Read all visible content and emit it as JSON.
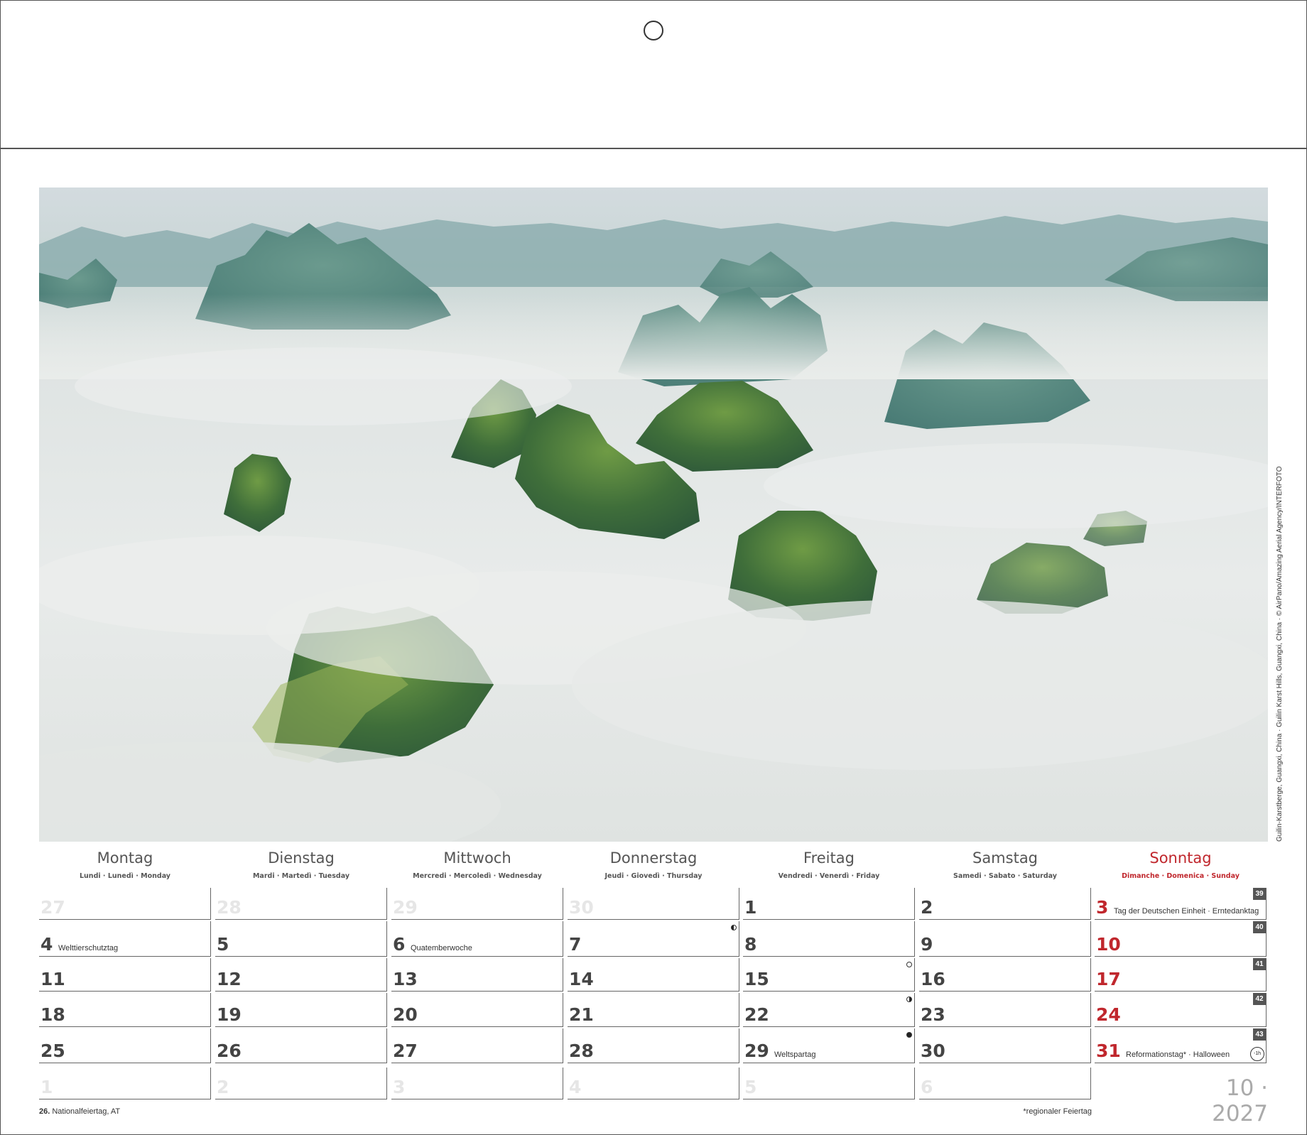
{
  "photo": {
    "credit": "Guilin-Karstberge, Guangxi, China · Guilin Karst Hills, Guangxi, China · © AirPano/Amazing Aerial Agency/INTERFOTO"
  },
  "weekdays": [
    {
      "name": "Montag",
      "sub": "Lundi · Lunedì · Monday"
    },
    {
      "name": "Dienstag",
      "sub": "Mardi · Martedì · Tuesday"
    },
    {
      "name": "Mittwoch",
      "sub": "Mercredi · Mercoledì · Wednesday"
    },
    {
      "name": "Donnerstag",
      "sub": "Jeudi · Giovedì · Thursday"
    },
    {
      "name": "Freitag",
      "sub": "Vendredi · Venerdì · Friday"
    },
    {
      "name": "Samstag",
      "sub": "Samedi · Sabato · Saturday"
    },
    {
      "name": "Sonntag",
      "sub": "Dimanche · Domenica · Sunday"
    }
  ],
  "weeks": [
    {
      "kw": "39",
      "days": [
        {
          "n": "27",
          "faded": true
        },
        {
          "n": "28",
          "faded": true
        },
        {
          "n": "29",
          "faded": true
        },
        {
          "n": "30",
          "faded": true
        },
        {
          "n": "1"
        },
        {
          "n": "2"
        },
        {
          "n": "3",
          "note": "Tag der Deutschen Einheit  ·  Erntedanktag"
        }
      ]
    },
    {
      "kw": "40",
      "days": [
        {
          "n": "4",
          "note": "Welttierschutztag"
        },
        {
          "n": "5"
        },
        {
          "n": "6",
          "note": "Quatemberwoche"
        },
        {
          "n": "7",
          "moon": "last"
        },
        {
          "n": "8"
        },
        {
          "n": "9"
        },
        {
          "n": "10"
        }
      ]
    },
    {
      "kw": "41",
      "days": [
        {
          "n": "11"
        },
        {
          "n": "12"
        },
        {
          "n": "13"
        },
        {
          "n": "14"
        },
        {
          "n": "15",
          "moon": "full"
        },
        {
          "n": "16"
        },
        {
          "n": "17"
        }
      ]
    },
    {
      "kw": "42",
      "days": [
        {
          "n": "18"
        },
        {
          "n": "19"
        },
        {
          "n": "20"
        },
        {
          "n": "21"
        },
        {
          "n": "22",
          "moon": "first"
        },
        {
          "n": "23"
        },
        {
          "n": "24"
        }
      ]
    },
    {
      "kw": "43",
      "days": [
        {
          "n": "25"
        },
        {
          "n": "26"
        },
        {
          "n": "27"
        },
        {
          "n": "28"
        },
        {
          "n": "29",
          "note": "Weltspartag",
          "moon": "new"
        },
        {
          "n": "30"
        },
        {
          "n": "31",
          "note": "Reformationstag*  ·  Halloween",
          "clock": "-1h"
        }
      ]
    },
    {
      "days": [
        {
          "n": "1",
          "faded": true
        },
        {
          "n": "2",
          "faded": true
        },
        {
          "n": "3",
          "faded": true
        },
        {
          "n": "4",
          "faded": true
        },
        {
          "n": "5",
          "faded": true
        },
        {
          "n": "6",
          "faded": true
        }
      ]
    }
  ],
  "month_label": "10 · 2027",
  "footer": {
    "left_day": "26.",
    "left_text": "Nationalfeiertag, AT",
    "right_text": "*regionaler Feiertag"
  },
  "colors": {
    "sunday": "#c0272d",
    "text": "#444444",
    "faded": "#e6e6e6"
  }
}
